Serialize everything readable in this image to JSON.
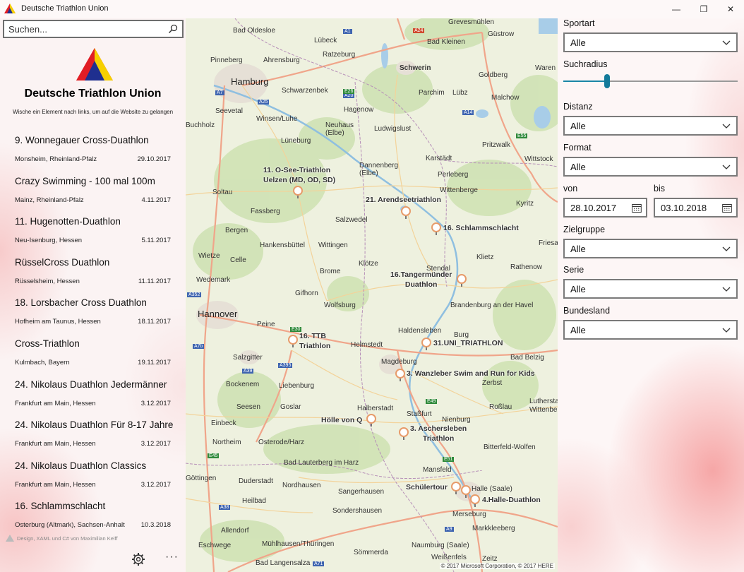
{
  "window": {
    "title": "Deutsche Triathlon Union",
    "minimize": "—",
    "restore": "❐",
    "close": "✕"
  },
  "sidebar": {
    "search_placeholder": "Suchen...",
    "org_title": "Deutsche Triathlon Union",
    "hint": "Wische ein Element nach links, um auf die Website zu gelangen",
    "events": [
      {
        "name": "9. Wonnegauer Cross-Duathlon",
        "location": "Monsheim, Rheinland-Pfalz",
        "date": "29.10.2017"
      },
      {
        "name": "Crazy Swimming - 100 mal 100m",
        "location": "Mainz, Rheinland-Pfalz",
        "date": "4.11.2017"
      },
      {
        "name": "11. Hugenotten-Duathlon",
        "location": "Neu-Isenburg, Hessen",
        "date": "5.11.2017"
      },
      {
        "name": "RüsselCross Duathlon",
        "location": "Rüsselsheim, Hessen",
        "date": "11.11.2017"
      },
      {
        "name": "18. Lorsbacher Cross Duathlon",
        "location": "Hofheim am Taunus, Hessen",
        "date": "18.11.2017"
      },
      {
        "name": "Cross-Triathlon",
        "location": "Kulmbach, Bayern",
        "date": "19.11.2017"
      },
      {
        "name": "24. Nikolaus Duathlon Jedermänner",
        "location": "Frankfurt am Main, Hessen",
        "date": "3.12.2017"
      },
      {
        "name": "24. Nikolaus Duathlon Für 8-17 Jahre",
        "location": "Frankfurt am Main, Hessen",
        "date": "3.12.2017"
      },
      {
        "name": "24. Nikolaus Duathlon Classics",
        "location": "Frankfurt am Main, Hessen",
        "date": "3.12.2017"
      },
      {
        "name": "16. Schlammschlacht",
        "location": "Osterburg (Altmark), Sachsen-Anhalt",
        "date": "10.3.2018"
      }
    ],
    "credit": "Design, XAML und C# von Maximilian Keiff",
    "more": "···"
  },
  "map": {
    "copyright": "© 2017 Microsoft Corporation, © 2017 HERE",
    "cities": [
      {
        "name": "Lübeck",
        "cls": ""
      },
      {
        "name": "Bad Oldesloe",
        "cls": ""
      },
      {
        "name": "Grevesmühlen",
        "cls": ""
      },
      {
        "name": "Güstrow",
        "cls": ""
      },
      {
        "name": "Bad Kleinen",
        "cls": ""
      },
      {
        "name": "Pinneberg",
        "cls": ""
      },
      {
        "name": "Ahrensburg",
        "cls": ""
      },
      {
        "name": "Ratzeburg",
        "cls": ""
      },
      {
        "name": "Schwerin",
        "cls": ""
      },
      {
        "name": "Hamburg",
        "cls": "big"
      },
      {
        "name": "Schwarzenbek",
        "cls": ""
      },
      {
        "name": "Goldberg",
        "cls": ""
      },
      {
        "name": "Waren",
        "cls": ""
      },
      {
        "name": "Parchim",
        "cls": ""
      },
      {
        "name": "Lübz",
        "cls": ""
      },
      {
        "name": "Malchow",
        "cls": ""
      },
      {
        "name": "Seevetal",
        "cls": ""
      },
      {
        "name": "Hagenow",
        "cls": ""
      },
      {
        "name": "Winsen/Luhe",
        "cls": ""
      },
      {
        "name": "Buchholz",
        "cls": ""
      },
      {
        "name": "Lüneburg",
        "cls": ""
      },
      {
        "name": "Neuhaus (Elbe)",
        "cls": ""
      },
      {
        "name": "Ludwigslust",
        "cls": ""
      },
      {
        "name": "Pritzwalk",
        "cls": ""
      },
      {
        "name": "Wittstock",
        "cls": ""
      },
      {
        "name": "Karstädt",
        "cls": ""
      },
      {
        "name": "Dannenberg (Elbe)",
        "cls": ""
      },
      {
        "name": "Perleberg",
        "cls": ""
      },
      {
        "name": "Soltau",
        "cls": ""
      },
      {
        "name": "Wittenberge",
        "cls": ""
      },
      {
        "name": "Fassberg",
        "cls": ""
      },
      {
        "name": "Salzwedel",
        "cls": ""
      },
      {
        "name": "Kyritz",
        "cls": ""
      },
      {
        "name": "Bergen",
        "cls": ""
      },
      {
        "name": "Hankensbüttel",
        "cls": ""
      },
      {
        "name": "Wittingen",
        "cls": ""
      },
      {
        "name": "Friesack",
        "cls": ""
      },
      {
        "name": "Wietze",
        "cls": ""
      },
      {
        "name": "Celle",
        "cls": ""
      },
      {
        "name": "Stendal",
        "cls": ""
      },
      {
        "name": "Rathenow",
        "cls": ""
      },
      {
        "name": "Klötze",
        "cls": ""
      },
      {
        "name": "Klietz",
        "cls": ""
      },
      {
        "name": "Brome",
        "cls": ""
      },
      {
        "name": "Wedemark",
        "cls": ""
      },
      {
        "name": "Gifhorn",
        "cls": ""
      },
      {
        "name": "Wolfsburg",
        "cls": ""
      },
      {
        "name": "Brandenburg an der Havel",
        "cls": ""
      },
      {
        "name": "Hannover",
        "cls": "big"
      },
      {
        "name": "Peine",
        "cls": ""
      },
      {
        "name": "Haldensleben",
        "cls": ""
      },
      {
        "name": "Burg",
        "cls": ""
      },
      {
        "name": "Helmstedt",
        "cls": ""
      },
      {
        "name": "Bad Belzig",
        "cls": ""
      },
      {
        "name": "Salzgitter",
        "cls": ""
      },
      {
        "name": "Magdeburg",
        "cls": ""
      },
      {
        "name": "Bockenem",
        "cls": ""
      },
      {
        "name": "Liebenburg",
        "cls": ""
      },
      {
        "name": "Zerbst",
        "cls": ""
      },
      {
        "name": "Seesen",
        "cls": ""
      },
      {
        "name": "Goslar",
        "cls": ""
      },
      {
        "name": "Halberstadt",
        "cls": ""
      },
      {
        "name": "Staßfurt",
        "cls": ""
      },
      {
        "name": "Roßlau",
        "cls": ""
      },
      {
        "name": "Einbeck",
        "cls": ""
      },
      {
        "name": "Nienburg",
        "cls": ""
      },
      {
        "name": "Northeim",
        "cls": ""
      },
      {
        "name": "Osterode/Harz",
        "cls": ""
      },
      {
        "name": "Bad Lauterberg im Harz",
        "cls": ""
      },
      {
        "name": "Bitterfeld-Wolfen",
        "cls": ""
      },
      {
        "name": "Mansfeld",
        "cls": ""
      },
      {
        "name": "Göttingen",
        "cls": ""
      },
      {
        "name": "Duderstadt",
        "cls": ""
      },
      {
        "name": "Nordhausen",
        "cls": ""
      },
      {
        "name": "Halle (Saale)",
        "cls": ""
      },
      {
        "name": "Sangerhausen",
        "cls": ""
      },
      {
        "name": "Heilbad",
        "cls": ""
      },
      {
        "name": "Sondershausen",
        "cls": ""
      },
      {
        "name": "Merseburg",
        "cls": ""
      },
      {
        "name": "Markkleeberg",
        "cls": ""
      },
      {
        "name": "Allendorf",
        "cls": ""
      },
      {
        "name": "Eschwege",
        "cls": ""
      },
      {
        "name": "Mühlhausen/Thüringen",
        "cls": ""
      },
      {
        "name": "Naumburg (Saale)",
        "cls": ""
      },
      {
        "name": "Sömmerda",
        "cls": ""
      },
      {
        "name": "Bad Langensalza",
        "cls": ""
      },
      {
        "name": "Weißenfels",
        "cls": ""
      },
      {
        "name": "Zeitz",
        "cls": ""
      },
      {
        "name": "Lutherstadt",
        "cls": ""
      },
      {
        "name": "Wittenberg",
        "cls": ""
      }
    ],
    "event_labels": [
      "11. O-See-Triathlon\nUelzen (MD, OD, SD)",
      "21. Arendseetriathlon",
      "16. Schlammschlacht",
      "16.Tangermünder\nDuathlon",
      "16. TTB\nTriathlon",
      "31.UNI_TRIATHLON",
      "3. Wanzleber Swim and Run for Kids",
      "Hölle von Q",
      "3. Aschersleben\nTriathlon",
      "Schülertour",
      "4.Halle-Duathlon"
    ],
    "roads": [
      "A7",
      "A25",
      "A1",
      "A20",
      "A24",
      "A14",
      "E26",
      "E55",
      "A352",
      "A39",
      "A395",
      "E30",
      "E45",
      "E49",
      "E51",
      "A9",
      "A38",
      "A71",
      "A7b"
    ]
  },
  "filters": {
    "sportart": {
      "label": "Sportart",
      "value": "Alle"
    },
    "suchradius": {
      "label": "Suchradius",
      "level": 0.25
    },
    "distanz": {
      "label": "Distanz",
      "value": "Alle"
    },
    "format": {
      "label": "Format",
      "value": "Alle"
    },
    "von": {
      "label": "von",
      "value": "28.10.2017"
    },
    "bis": {
      "label": "bis",
      "value": "03.10.2018"
    },
    "zielgruppe": {
      "label": "Zielgruppe",
      "value": "Alle"
    },
    "serie": {
      "label": "Serie",
      "value": "Alle"
    },
    "bundesland": {
      "label": "Bundesland",
      "value": "Alle"
    }
  }
}
